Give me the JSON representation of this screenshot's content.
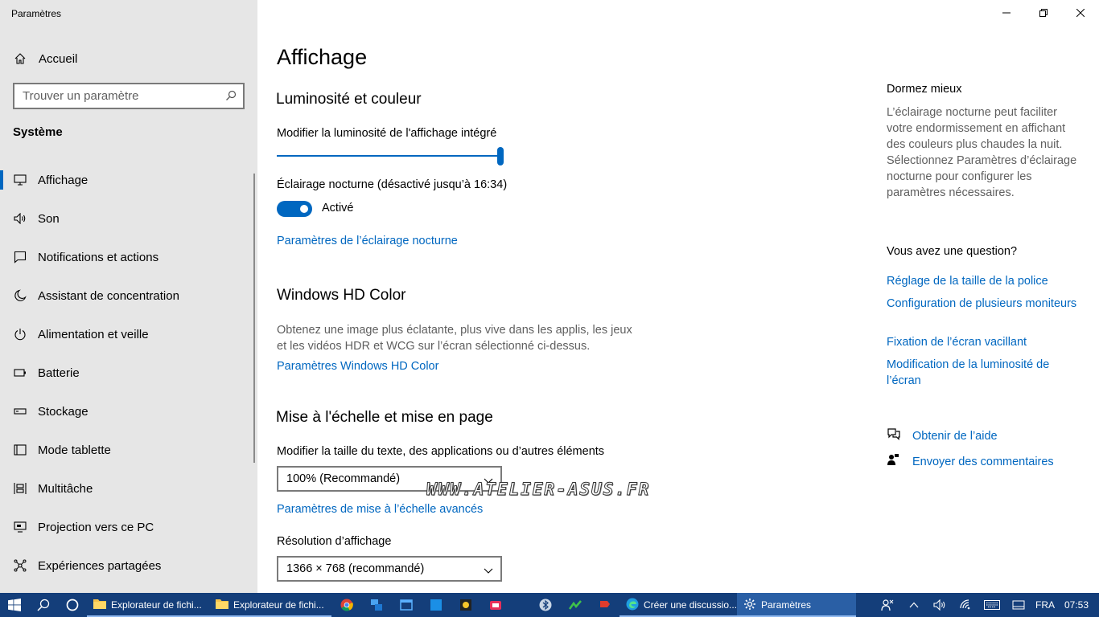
{
  "window": {
    "title": "Paramètres"
  },
  "sidebar": {
    "home_label": "Accueil",
    "search_placeholder": "Trouver un paramètre",
    "section_label": "Système",
    "items": [
      {
        "label": "Affichage",
        "icon": "monitor-icon",
        "active": true
      },
      {
        "label": "Son",
        "icon": "speaker-icon"
      },
      {
        "label": "Notifications et actions",
        "icon": "notification-icon"
      },
      {
        "label": "Assistant de concentration",
        "icon": "moon-icon"
      },
      {
        "label": "Alimentation et veille",
        "icon": "power-icon"
      },
      {
        "label": "Batterie",
        "icon": "battery-icon"
      },
      {
        "label": "Stockage",
        "icon": "storage-icon"
      },
      {
        "label": "Mode tablette",
        "icon": "tablet-icon"
      },
      {
        "label": "Multitâche",
        "icon": "multitask-icon"
      },
      {
        "label": "Projection vers ce PC",
        "icon": "projection-icon"
      },
      {
        "label": "Expériences partagées",
        "icon": "shared-icon"
      }
    ]
  },
  "main": {
    "page_title": "Affichage",
    "brightness": {
      "heading": "Luminosité et couleur",
      "slider_label": "Modifier la luminosité de l'affichage intégré",
      "slider_value": 1.0
    },
    "night_light": {
      "label": "Éclairage nocturne (désactivé jusqu’à 16:34)",
      "toggle_state": "Activé",
      "toggle_on": true,
      "settings_link": "Paramètres de l’éclairage nocturne"
    },
    "hd_color": {
      "heading": "Windows HD Color",
      "description_line1": "Obtenez une image plus éclatante, plus vive dans les applis, les jeux",
      "description_line2": "et les vidéos HDR et WCG sur l’écran sélectionné ci-dessus.",
      "link": "Paramètres Windows HD Color"
    },
    "scaling": {
      "heading": "Mise à l'échelle et mise en page",
      "size_label": "Modifier la taille du texte, des applications ou d’autres éléments",
      "size_value": "100% (Recommandé)",
      "advanced_link": "Paramètres de mise à l’échelle avancés",
      "resolution_label": "Résolution d’affichage",
      "resolution_value": "1366 × 768 (recommandé)"
    },
    "watermark": "WWW.ATELIER-ASUS.FR"
  },
  "aside": {
    "sleep_heading": "Dormez mieux",
    "sleep_desc": "L’éclairage nocturne peut faciliter votre endormissement en affichant des couleurs plus chaudes la nuit. Sélectionnez Paramètres d’éclairage nocturne pour configurer les paramètres nécessaires.",
    "question_heading": "Vous avez une question?",
    "links": [
      "Réglage de la taille de la police",
      "Configuration de plusieurs moniteurs",
      "Fixation de l’écran vacillant",
      "Modification de la luminosité de l’écran"
    ],
    "help_label": "Obtenir de l’aide",
    "feedback_label": "Envoyer des commentaires"
  },
  "taskbar": {
    "apps": [
      {
        "label": "Explorateur de fichi...",
        "icon": "folder-icon"
      },
      {
        "label": "Explorateur de fichi...",
        "icon": "folder-icon"
      },
      {
        "label": "Créer une discussio...",
        "icon": "edge-icon"
      },
      {
        "label": "Paramètres",
        "icon": "gear-icon"
      }
    ],
    "language": "FRA",
    "time": "07:53"
  },
  "colors": {
    "accent": "#0067c0",
    "sidebar_bg": "#e6e6e6",
    "taskbar_bg": "#143e7a",
    "taskbar_active": "#2a5fa5"
  }
}
